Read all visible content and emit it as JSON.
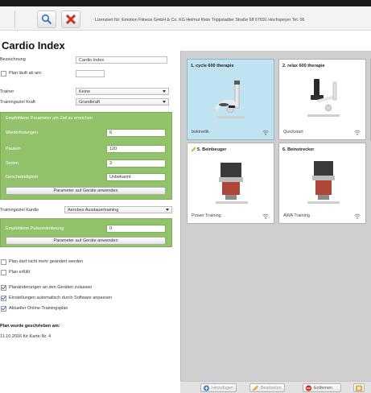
{
  "toolbar": {
    "search_icon": "magnifier-icon",
    "delete_icon": "red-x-icon",
    "license": "Lizenziert für: Emotion Fitness GmbH & Co. KG Helmut Klein Trippstadter Straße 68 67691 Hochspeyer Tel. 06"
  },
  "page": {
    "title": "Cardio Index"
  },
  "form": {
    "bezeichnung_label": "Bezeichnung",
    "bezeichnung_value": "Cardio Index",
    "plan_laeuft_label": "Plan läuft ab am:",
    "trainer_label": "Trainer",
    "trainer_value": "Keine",
    "ziel_kraft_label": "Trainingsziel Kraft",
    "ziel_kraft_value": "Grundkraft",
    "green1": {
      "heading": "Empfohlene Parameter um Ziel zu erreichen",
      "rows": [
        {
          "label": "Wiederholungen",
          "value": "6"
        },
        {
          "label": "Pausen",
          "value": "120"
        },
        {
          "label": "Serien",
          "value": "3"
        },
        {
          "label": "Geschwindigkeit",
          "value": "Unbekannt"
        }
      ],
      "button": "Parameter auf Geräte anwenden"
    },
    "ziel_cardio_label": "Trainingsziel Kardio",
    "ziel_cardio_value": "Aerobes Ausdauertraining",
    "green2": {
      "label": "Empfohlene Pulsveränderung",
      "value": "0",
      "button": "Parameter auf Geräte anwenden"
    },
    "checks": [
      {
        "label": "Plan darf nicht mehr geändert werden",
        "checked": false
      },
      {
        "label": "Plan erfüllt",
        "checked": false
      },
      {
        "label": "Planänderungen an den Geräten zulassen",
        "checked": true
      },
      {
        "label": "Einstellungen automatisch durch Software anpassen",
        "checked": true
      },
      {
        "label": "Aktueller Online-Trainingsplan",
        "checked": true
      }
    ],
    "written_label": "Plan wurde geschrieben am:",
    "written_value": "11.10.2016 für Karte-Nr. 4"
  },
  "cards": [
    {
      "title": "1. cycle 600 therapie",
      "subtitle": "bokinetik",
      "selected": true
    },
    {
      "title": "2. relax 600 therapie",
      "subtitle": "Quickstart",
      "selected": false
    },
    {
      "title": "5. Beinbeuger",
      "subtitle": "Power Training",
      "selected": false
    },
    {
      "title": "6. Beinstrecker",
      "subtitle": "AWA Training",
      "selected": false
    }
  ],
  "bottom": {
    "add_label": "Hinzufügen",
    "edit_label": "Bearbeiten",
    "remove_label": "Entfernen"
  },
  "colors": {
    "green_panel": "#92c36b",
    "card_selected": "#bfe3f1",
    "right_bg": "#cfcfcf"
  }
}
